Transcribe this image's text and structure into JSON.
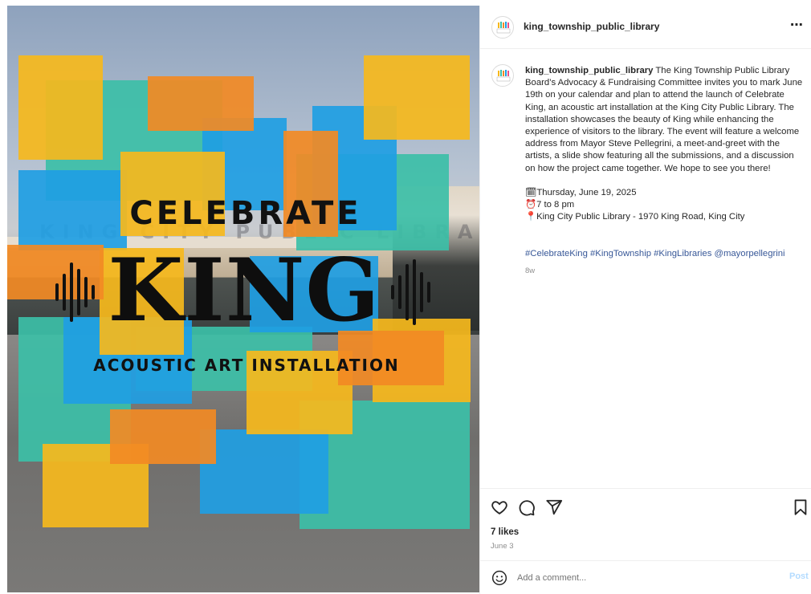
{
  "post": {
    "username": "king_township_public_library",
    "more_icon": "⋯",
    "avatar_text": "LIBRARY",
    "image": {
      "headline_top": "CELEBRATE",
      "headline_main": "KING",
      "headline_bottom": "ACOUSTIC ART INSTALLATION",
      "signage": "KING CITY PUBLIC LIBRARY"
    },
    "caption": {
      "username": "king_township_public_library",
      "body": "The King Township Public Library Board’s Advocacy & Fundraising Committee invites you to mark June 19th on your calendar and plan to attend the launch of Celebrate King, an acoustic art installation at the King City Public Library. The installation showcases the beauty of King while enhancing the experience of visitors to the library. The event will feature a welcome address from Mayor Steve Pellegrini, a meet-and-greet with the artists, a slide show featuring all the submissions, and a discussion on how the project came together. We hope to see you there!",
      "date_line": "🗓Thursday, June 19, 2025",
      "time_line": "⏰7 to 8 pm",
      "location_line": "📍King City Public Library - 1970 King Road, King City",
      "hashtags": "#CelebrateKing #KingTownship #KingLibraries @mayorpellegrini",
      "time_ago": "8w"
    },
    "likes": "7 likes",
    "date": "June 3",
    "comment": {
      "placeholder": "Add a comment...",
      "post_label": "Post"
    },
    "colors": {
      "accent_link": "#385898",
      "tile_yellow": "#f6b81c",
      "tile_orange": "#f28a24",
      "tile_blue": "#1f9ee3",
      "tile_teal": "#3cbfa7",
      "post_disabled": "#b3dbff"
    },
    "icons": [
      "heart-icon",
      "comment-icon",
      "share-icon",
      "bookmark-icon",
      "emoji-icon",
      "more-icon"
    ]
  }
}
